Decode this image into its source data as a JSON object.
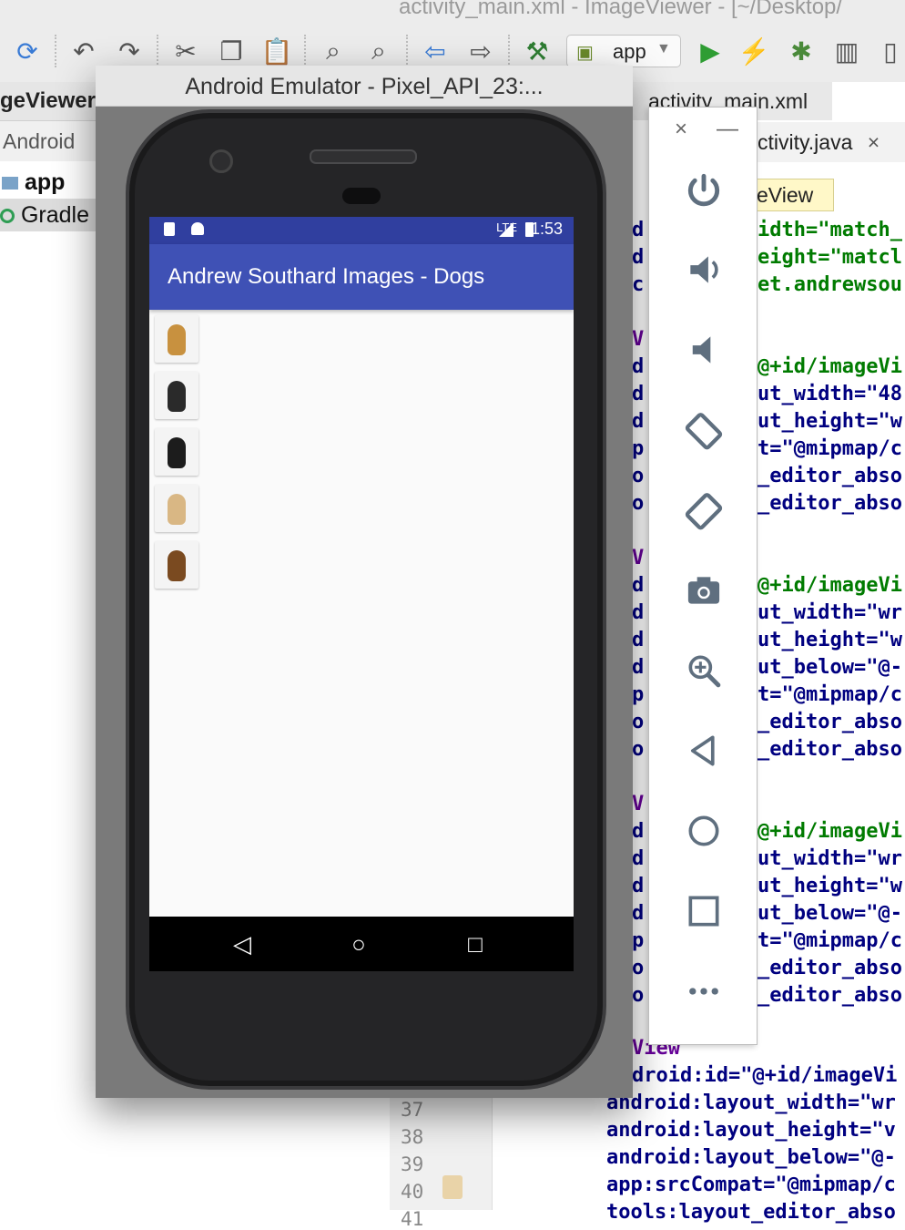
{
  "ide": {
    "window_title": "activity_main.xml - ImageViewer - [~/Desktop/",
    "project_header": "geViewer",
    "project_view": "Android",
    "tree": [
      {
        "label": "app"
      },
      {
        "label": "Gradle"
      }
    ],
    "run_config": "app",
    "tabs": [
      "activity_main.xml",
      "ctivity.java"
    ],
    "tab_close": "×",
    "breadcrumb": "eView",
    "line_numbers": [
      "37",
      "38",
      "39",
      "40",
      "41"
    ],
    "code_right": [
      {
        "text": "idth=\"match_",
        "cls": "val"
      },
      {
        "text": "eight=\"matcl",
        "cls": "val"
      },
      {
        "text": "et.andrewsou",
        "cls": "val"
      },
      {
        "text": "",
        "cls": "val"
      },
      {
        "text": "",
        "cls": "val"
      },
      {
        "text": "@+id/imageVi",
        "cls": "val"
      },
      {
        "text": "ut_width=\"48",
        "cls": "kw"
      },
      {
        "text": "ut_height=\"w",
        "cls": "kw"
      },
      {
        "text": "t=\"@mipmap/c",
        "cls": "kw"
      },
      {
        "text": "_editor_abso",
        "cls": "kw"
      },
      {
        "text": "_editor_abso",
        "cls": "kw"
      },
      {
        "text": "",
        "cls": "kw"
      },
      {
        "text": "",
        "cls": "kw"
      },
      {
        "text": "@+id/imageVi",
        "cls": "val"
      },
      {
        "text": "ut_width=\"wr",
        "cls": "kw"
      },
      {
        "text": "ut_height=\"w",
        "cls": "kw"
      },
      {
        "text": "ut_below=\"@-",
        "cls": "kw"
      },
      {
        "text": "t=\"@mipmap/c",
        "cls": "kw"
      },
      {
        "text": "_editor_abso",
        "cls": "kw"
      },
      {
        "text": "_editor_abso",
        "cls": "kw"
      },
      {
        "text": "",
        "cls": "kw"
      },
      {
        "text": "",
        "cls": "kw"
      },
      {
        "text": "@+id/imageVi",
        "cls": "val"
      },
      {
        "text": "ut_width=\"wr",
        "cls": "kw"
      },
      {
        "text": "ut_height=\"w",
        "cls": "kw"
      },
      {
        "text": "ut_below=\"@-",
        "cls": "kw"
      },
      {
        "text": "t=\"@mipmap/c",
        "cls": "kw"
      },
      {
        "text": "_editor_abso",
        "cls": "kw"
      },
      {
        "text": "_editor_abso",
        "cls": "kw"
      }
    ],
    "code_left_letters": [
      "d",
      "d",
      "c",
      "",
      "V:",
      "d",
      "d",
      "d",
      "p",
      "o",
      "o",
      "",
      "V:",
      "d",
      "d",
      "d",
      "d",
      "p",
      "o",
      "o",
      "",
      "V:",
      "d",
      "d",
      "d",
      "d",
      "p",
      "o",
      "o"
    ],
    "code_bottom": [
      {
        "text": "View",
        "cls": "attr"
      },
      {
        "text": "droid:id=\"@+id/imageVi",
        "cls": "kw"
      },
      {
        "text": "android:layout_width=\"wr",
        "cls": "kw"
      },
      {
        "text": "android:layout_height=\"v",
        "cls": "kw"
      },
      {
        "text": "android:layout_below=\"@-",
        "cls": "kw"
      },
      {
        "text": "app:srcCompat=\"@mipmap/c",
        "cls": "kw"
      },
      {
        "text": "tools:layout_editor_abso",
        "cls": "kw"
      }
    ]
  },
  "emulator": {
    "title": "Android Emulator - Pixel_API_23:...",
    "status_time": "1:53",
    "status_lte": "LTE",
    "app_title": "Andrew Southard Images - Dogs",
    "thumbnails": [
      {
        "name": "golden-retriever",
        "color": "#c8913f"
      },
      {
        "name": "small-black-tan-dog",
        "color": "#2a2a2a"
      },
      {
        "name": "bernese-mountain-dog",
        "color": "#1c1c1c"
      },
      {
        "name": "yellow-labrador",
        "color": "#d9b784"
      },
      {
        "name": "german-shepherd",
        "color": "#7a4a20"
      }
    ],
    "nav": [
      "◁",
      "○",
      "□"
    ]
  },
  "controls": {
    "close": "×",
    "minimize": "—",
    "buttons": [
      {
        "name": "power"
      },
      {
        "name": "volume-up"
      },
      {
        "name": "volume-down"
      },
      {
        "name": "rotate-left"
      },
      {
        "name": "rotate-right"
      },
      {
        "name": "screenshot"
      },
      {
        "name": "zoom"
      },
      {
        "name": "back"
      },
      {
        "name": "home"
      },
      {
        "name": "overview"
      },
      {
        "name": "more"
      }
    ]
  },
  "colors": {
    "status_bar": "#303f9f",
    "app_bar": "#3f51b5",
    "control_icon": "#5f6f7f"
  }
}
